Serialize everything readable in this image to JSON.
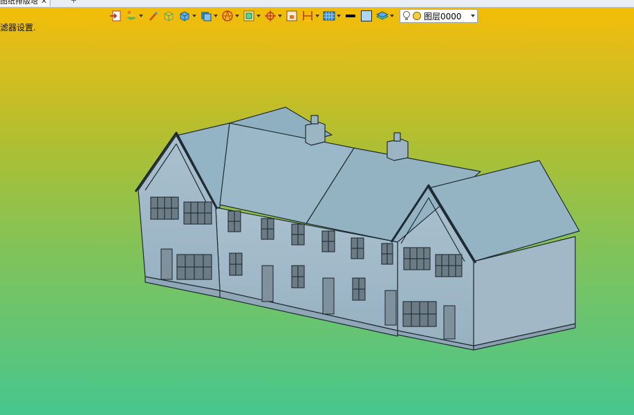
{
  "tab": {
    "title": "图纸排版塔",
    "close_glyph": "✕",
    "new_tab_glyph": "+"
  },
  "toolbar": {
    "items": [
      {
        "name": "import-icon",
        "has_dropdown": false
      },
      {
        "name": "layers-paint-icon",
        "has_dropdown": true
      },
      {
        "name": "pen-icon",
        "has_dropdown": false
      },
      {
        "name": "solid-shade-icon",
        "has_dropdown": false
      },
      {
        "name": "cube-icon",
        "has_dropdown": true
      },
      {
        "name": "view-cube-icon",
        "has_dropdown": true
      },
      {
        "name": "section-sphere-icon",
        "has_dropdown": true
      },
      {
        "name": "box-frame-icon",
        "has_dropdown": true
      },
      {
        "name": "snap-target-icon",
        "has_dropdown": true
      },
      {
        "name": "small-box-icon",
        "has_dropdown": false
      },
      {
        "name": "dimension-icon",
        "has_dropdown": true
      },
      {
        "name": "render-grid-icon",
        "has_dropdown": true
      },
      {
        "name": "line-weight-icon",
        "has_dropdown": false
      },
      {
        "name": "color-swatch-icon",
        "has_dropdown": false
      },
      {
        "name": "layer-stack-icon",
        "has_dropdown": true
      }
    ],
    "layer_select": {
      "value": "图层0000",
      "icons": [
        "bulb-icon",
        "layer-color-dot-icon"
      ]
    }
  },
  "status": {
    "message": "滤器设置."
  },
  "colors": {
    "background_top": "#f7bd00",
    "background_bottom": "#47c68e",
    "model_face": "#a6bccb",
    "model_roof": "#93b4c4",
    "model_edge": "#1f2b33"
  }
}
